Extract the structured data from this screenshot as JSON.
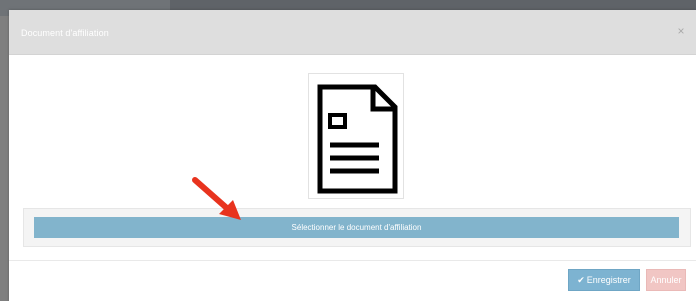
{
  "modal": {
    "title": "Document d'affiliation",
    "close_label": "×"
  },
  "document_preview": {
    "icon": "document-icon"
  },
  "select_button": {
    "label": "Sélectionner le document d'affiliation"
  },
  "footer": {
    "save_icon": "check-icon",
    "save_check": "✔",
    "save_label": "Enregistrer",
    "cancel_label": "Annuler"
  },
  "annotation": {
    "icon": "red-arrow-icon"
  },
  "colors": {
    "header_bg": "#dedede",
    "select_button_bg": "#82b4cc",
    "save_button_bg": "#7db3d1",
    "cancel_button_bg": "#f1c6c4",
    "arrow": "#e8331e"
  }
}
